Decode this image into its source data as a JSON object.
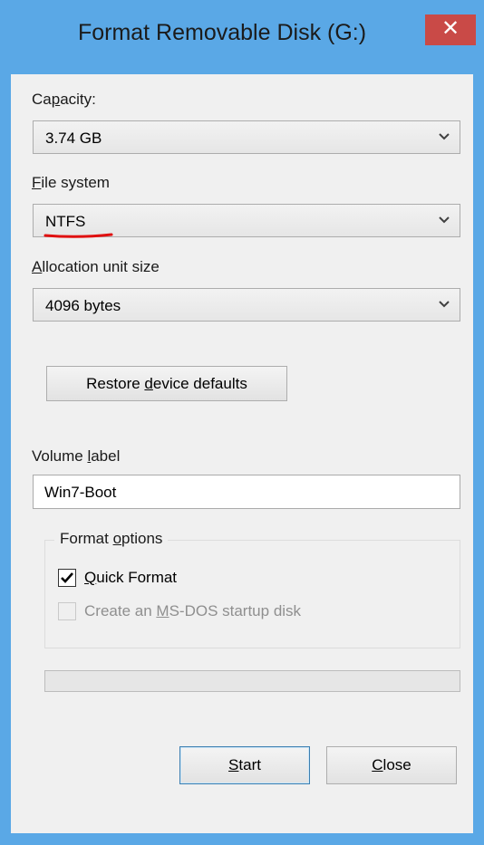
{
  "window": {
    "title": "Format Removable Disk (G:)",
    "close_glyph": "✕"
  },
  "capacity": {
    "label_pre": "Ca",
    "label_u": "p",
    "label_post": "acity:",
    "value": "3.74 GB"
  },
  "file_system": {
    "label_pre": "",
    "label_u": "F",
    "label_post": "ile system",
    "value": "NTFS"
  },
  "allocation": {
    "label_pre": "",
    "label_u": "A",
    "label_post": "llocation unit size",
    "value": "4096 bytes"
  },
  "restore_button": {
    "pre": "Restore ",
    "u": "d",
    "post": "evice defaults"
  },
  "volume_label": {
    "label_pre": "Volume ",
    "label_u": "l",
    "label_post": "abel",
    "value": "Win7-Boot"
  },
  "format_options": {
    "legend_pre": "Format ",
    "legend_u": "o",
    "legend_post": "ptions",
    "quick_format": {
      "checked": true,
      "pre": "",
      "u": "Q",
      "post": "uick Format"
    },
    "msdos": {
      "checked": false,
      "enabled": false,
      "pre": "Create an ",
      "u": "M",
      "post": "S-DOS startup disk"
    }
  },
  "progress": {
    "value": 0
  },
  "buttons": {
    "start_u": "S",
    "start_post": "tart",
    "close_u": "C",
    "close_post": "lose"
  },
  "colors": {
    "title_bar": "#5aa8e6",
    "close_button": "#c94a47",
    "annotation_underline": "#e01010"
  }
}
